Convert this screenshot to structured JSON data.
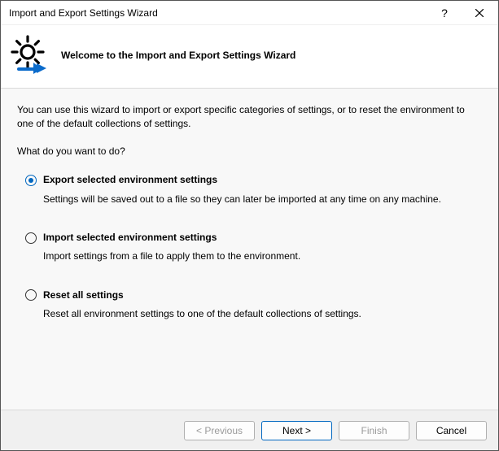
{
  "window": {
    "title": "Import and Export Settings Wizard"
  },
  "header": {
    "title": "Welcome to the Import and Export Settings Wizard"
  },
  "content": {
    "intro": "You can use this wizard to import or export specific categories of settings, or to reset the environment to one of the default collections of settings.",
    "prompt": "What do you want to do?",
    "options": [
      {
        "label": "Export selected environment settings",
        "description": "Settings will be saved out to a file so they can later be imported at any time on any machine.",
        "checked": true
      },
      {
        "label": "Import selected environment settings",
        "description": "Import settings from a file to apply them to the environment.",
        "checked": false
      },
      {
        "label": "Reset all settings",
        "description": "Reset all environment settings to one of the default collections of settings.",
        "checked": false
      }
    ]
  },
  "footer": {
    "previous": "< Previous",
    "next": "Next >",
    "finish": "Finish",
    "cancel": "Cancel"
  }
}
